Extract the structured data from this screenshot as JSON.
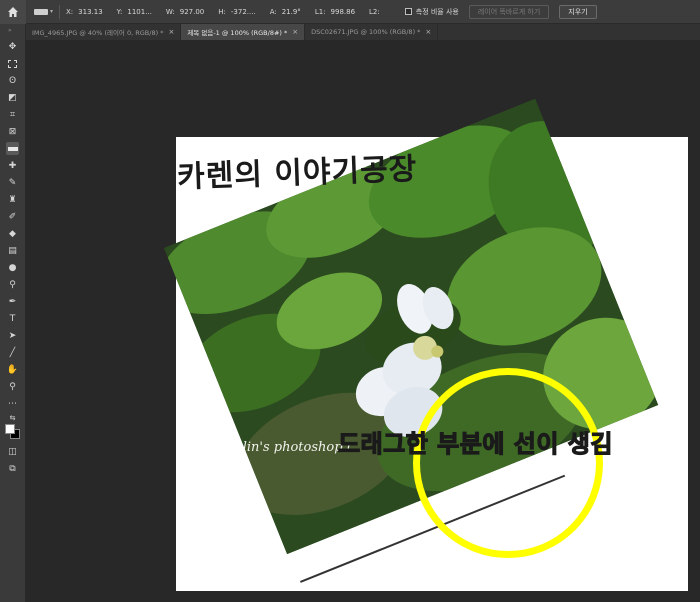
{
  "options_bar": {
    "x": {
      "label": "X:",
      "value": "313.13"
    },
    "y": {
      "label": "Y:",
      "value": "1101..."
    },
    "w": {
      "label": "W:",
      "value": "927.00"
    },
    "h": {
      "label": "H:",
      "value": "-372...."
    },
    "a": {
      "label": "A:",
      "value": "21.9°"
    },
    "l1": {
      "label": "L1:",
      "value": "998.86"
    },
    "l2": {
      "label": "L2:",
      "value": ""
    },
    "use_measure_scale": "측정 비율 사용",
    "straighten_layer": "레이어 똑바르게 하기",
    "clear": "지우기"
  },
  "tabs": [
    {
      "label": "IMG_4965.JPG @ 40% (레이어 0, RGB/8) *",
      "close": "×"
    },
    {
      "label": "제목 없음-1 @ 100% (RGB/8#) *",
      "close": "×"
    },
    {
      "label": "DSC02671.JPG @ 100% (RGB/8) *",
      "close": "×"
    }
  ],
  "canvas": {
    "title": "카렌의 이야기공장",
    "watermark": "Calin's photoshop t",
    "annotation": "드래그한 부분에 선이 생김"
  },
  "colors": {
    "foreground": "#ffffff",
    "background": "#000000",
    "annotation": "#ffff00"
  }
}
